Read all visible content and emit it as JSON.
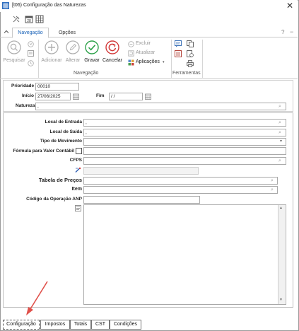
{
  "window": {
    "title": "[t06) Configuração das Naturezas",
    "close_glyph": "✕"
  },
  "ribbon": {
    "tabs": [
      {
        "label": "Navegação",
        "active": true
      },
      {
        "label": "Opções",
        "active": false
      }
    ],
    "help_glyph": "?",
    "minimize_glyph": "−",
    "buttons": {
      "pesquisar": "Pesquisar",
      "adicionar": "Adicionar",
      "alterar": "Alterar",
      "gravar": "Gravar",
      "cancelar": "Cancelar",
      "excluir": "Excluir",
      "atualizar": "Atualizar",
      "aplicacoes": "Aplicações"
    },
    "groups": {
      "navegacao": "Navegação",
      "ferramentas": "Ferramentas"
    }
  },
  "form": {
    "prioridade": {
      "label": "Prioridade",
      "value": "00010"
    },
    "inicio": {
      "label": "Início",
      "value": "27/06/2025"
    },
    "fim": {
      "label": "Fim",
      "value": " / /"
    },
    "natureza": {
      "label": "Natureza",
      "value": ","
    },
    "local_entrada": {
      "label": "Local de Entrada",
      "value": ","
    },
    "local_saida": {
      "label": "Local de Saída",
      "value": ","
    },
    "tipo_movimento": {
      "label": "Tipo de Movimento",
      "value": ""
    },
    "formula_valor": {
      "label": "Fórmula para Valor Contábil",
      "value": ""
    },
    "cfps": {
      "label": "CFPS",
      "value": ""
    },
    "tabela_precos": {
      "label": "Tabela de Preços",
      "value": ""
    },
    "item": {
      "label": "Item",
      "value": ""
    },
    "codigo_anp": {
      "label": "Código da Operação ANP",
      "value": ""
    }
  },
  "bottom_tabs": [
    {
      "label": "Configuração",
      "selected": true
    },
    {
      "label": "Impostos",
      "selected": false
    },
    {
      "label": "Totais",
      "selected": false
    },
    {
      "label": "CST",
      "selected": false
    },
    {
      "label": "Condições",
      "selected": false
    }
  ],
  "colors": {
    "accent": "#1a63b8",
    "gravar": "#2ea24a",
    "cancelar": "#d23a3a",
    "arrow": "#e0504a"
  }
}
